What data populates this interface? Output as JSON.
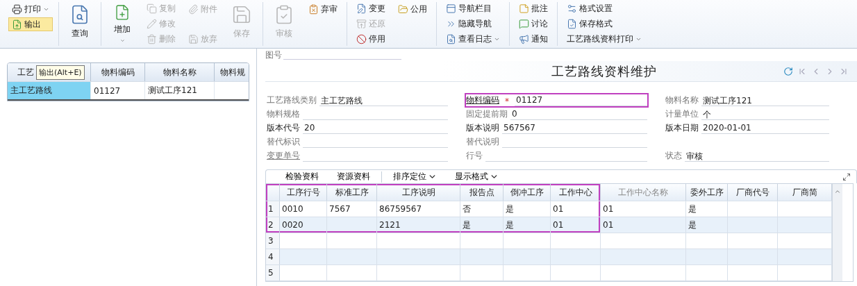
{
  "toolbar": {
    "groups": [
      {
        "columns": [
          [
            {
              "label": "打印",
              "kind": "small",
              "disabled": false,
              "dropdown": true,
              "hovered": false
            },
            {
              "label": "输出",
              "kind": "small",
              "disabled": false,
              "dropdown": false,
              "hovered": true
            }
          ]
        ]
      },
      {
        "columns": [
          [
            {
              "label": "查询",
              "kind": "large",
              "disabled": false,
              "dropdown": false,
              "hovered": false
            }
          ]
        ]
      },
      {
        "columns": [
          [
            {
              "label": "增加",
              "kind": "large",
              "disabled": false,
              "dropdown": true,
              "hovered": false
            }
          ],
          [
            {
              "label": "复制",
              "kind": "small",
              "disabled": true,
              "dropdown": false,
              "hovered": false
            },
            {
              "label": "修改",
              "kind": "small",
              "disabled": true,
              "dropdown": false,
              "hovered": false
            },
            {
              "label": "删除",
              "kind": "small",
              "disabled": true,
              "dropdown": false,
              "hovered": false
            }
          ],
          [
            {
              "label": "附件",
              "kind": "small",
              "disabled": true,
              "dropdown": false,
              "hovered": false
            },
            {
              "label": "放弃",
              "kind": "small",
              "disabled": true,
              "dropdown": false,
              "hovered": false
            }
          ],
          [
            {
              "label": "保存",
              "kind": "large",
              "disabled": true,
              "dropdown": false,
              "hovered": false
            }
          ]
        ]
      },
      {
        "columns": [
          [
            {
              "label": "审核",
              "kind": "large",
              "disabled": true,
              "dropdown": false,
              "hovered": false
            }
          ],
          [
            {
              "label": "弃审",
              "kind": "small",
              "disabled": false,
              "dropdown": false,
              "hovered": false
            }
          ]
        ]
      },
      {
        "columns": [
          [
            {
              "label": "变更",
              "kind": "small",
              "disabled": false,
              "dropdown": false,
              "hovered": false
            },
            {
              "label": "还原",
              "kind": "small",
              "disabled": true,
              "dropdown": false,
              "hovered": false
            },
            {
              "label": "停用",
              "kind": "small",
              "disabled": false,
              "dropdown": false,
              "hovered": false
            }
          ],
          [
            {
              "label": "公用",
              "kind": "small",
              "disabled": false,
              "dropdown": false,
              "hovered": false
            }
          ]
        ]
      },
      {
        "columns": [
          [
            {
              "label": "导航栏目",
              "kind": "small",
              "disabled": false,
              "dropdown": false,
              "hovered": false
            },
            {
              "label": "隐藏导航",
              "kind": "small",
              "disabled": false,
              "dropdown": false,
              "hovered": false
            },
            {
              "label": "查看日志",
              "kind": "small",
              "disabled": false,
              "dropdown": true,
              "hovered": false
            }
          ]
        ]
      },
      {
        "columns": [
          [
            {
              "label": "批注",
              "kind": "small",
              "disabled": false,
              "dropdown": false,
              "hovered": false
            },
            {
              "label": "讨论",
              "kind": "small",
              "disabled": false,
              "dropdown": false,
              "hovered": false
            },
            {
              "label": "通知",
              "kind": "small",
              "disabled": false,
              "dropdown": false,
              "hovered": false
            }
          ]
        ]
      },
      {
        "columns": [
          [
            {
              "label": "格式设置",
              "kind": "small",
              "disabled": false,
              "dropdown": false,
              "hovered": false
            },
            {
              "label": "保存格式",
              "kind": "small",
              "disabled": false,
              "dropdown": false,
              "hovered": false
            },
            {
              "label": "工艺路线资料打印",
              "kind": "text",
              "disabled": false,
              "dropdown": true,
              "hovered": false
            }
          ]
        ]
      }
    ]
  },
  "tooltip": "输出(Alt+E)",
  "list": {
    "columns": [
      "工艺",
      "物料编码",
      "物料名称",
      "物料规"
    ],
    "rows": [
      {
        "cells": [
          "主工艺路线",
          "01127",
          "测试工序121",
          null
        ],
        "selected": true
      }
    ]
  },
  "drawing_number": {
    "label": "图号"
  },
  "title": "工艺路线资料维护",
  "form": {
    "rows": [
      [
        {
          "label": "工艺路线类别",
          "value": "主工艺路线",
          "emphasis": false,
          "link": false,
          "highlighted": false
        },
        {
          "label": "物料编码",
          "value": "01127",
          "emphasis": true,
          "link": true,
          "required_mark": "*",
          "highlighted": true
        },
        {
          "label": "物料名称",
          "value": "测试工序121",
          "emphasis": false,
          "link": false,
          "highlighted": false
        }
      ],
      [
        {
          "label": "物料规格",
          "emphasis": false,
          "link": false,
          "highlighted": false
        },
        {
          "label": "固定提前期",
          "value": "0",
          "emphasis": false,
          "link": false,
          "highlighted": false
        },
        {
          "label": "计量单位",
          "value": "个",
          "emphasis": false,
          "link": false,
          "highlighted": false
        }
      ],
      [
        {
          "label": "版本代号",
          "value": "20",
          "emphasis": true,
          "link": false,
          "highlighted": false
        },
        {
          "label": "版本说明",
          "value": "567567",
          "emphasis": true,
          "link": false,
          "highlighted": false
        },
        {
          "label": "版本日期",
          "value": "2020-01-01",
          "emphasis": true,
          "link": false,
          "highlighted": false
        }
      ],
      [
        {
          "label": "替代标识",
          "emphasis": false,
          "link": false,
          "highlighted": false
        },
        {
          "label": "替代说明",
          "emphasis": false,
          "link": false,
          "highlighted": false
        },
        null
      ],
      [
        {
          "label": "变更单号",
          "emphasis": false,
          "link": true,
          "highlighted": false
        },
        {
          "label": "行号",
          "emphasis": false,
          "link": false,
          "highlighted": false
        },
        {
          "label": "状态",
          "value": "审核",
          "emphasis": false,
          "link": false,
          "highlighted": false
        }
      ]
    ]
  },
  "detail_toolbar": [
    {
      "label": "检验资料",
      "dropdown": false
    },
    {
      "label": "资源资料",
      "dropdown": false
    },
    {
      "label": "排序定位",
      "dropdown": true
    },
    {
      "label": "显示格式",
      "dropdown": true
    }
  ],
  "detail_grid": {
    "columns": [
      {
        "label": "工序行号",
        "disabled": false,
        "highlighted": true
      },
      {
        "label": "标准工序",
        "disabled": false,
        "highlighted": true
      },
      {
        "label": "工序说明",
        "disabled": false,
        "highlighted": true
      },
      {
        "label": "报告点",
        "disabled": false,
        "highlighted": true
      },
      {
        "label": "倒冲工序",
        "disabled": false,
        "highlighted": true
      },
      {
        "label": "工作中心",
        "disabled": false,
        "highlighted": true
      },
      {
        "label": "工作中心名称",
        "disabled": true,
        "highlighted": false
      },
      {
        "label": "委外工序",
        "disabled": false,
        "highlighted": false
      },
      {
        "label": "厂商代号",
        "disabled": false,
        "highlighted": false
      },
      {
        "label": "厂商简",
        "disabled": false,
        "highlighted": false
      }
    ],
    "rows": [
      {
        "number": "1",
        "highlighted": true,
        "cells": [
          "0010",
          "7567",
          "86759567",
          "否",
          "是",
          "01",
          "01",
          "是",
          null,
          null
        ]
      },
      {
        "number": "2",
        "highlighted": true,
        "cells": [
          "0020",
          null,
          "2121",
          "是",
          "是",
          "01",
          "01",
          "是",
          null,
          null
        ]
      },
      {
        "number": "3",
        "highlighted": false,
        "cells": []
      },
      {
        "number": "4",
        "highlighted": false,
        "cells": []
      },
      {
        "number": "5",
        "highlighted": false,
        "cells": []
      }
    ]
  }
}
